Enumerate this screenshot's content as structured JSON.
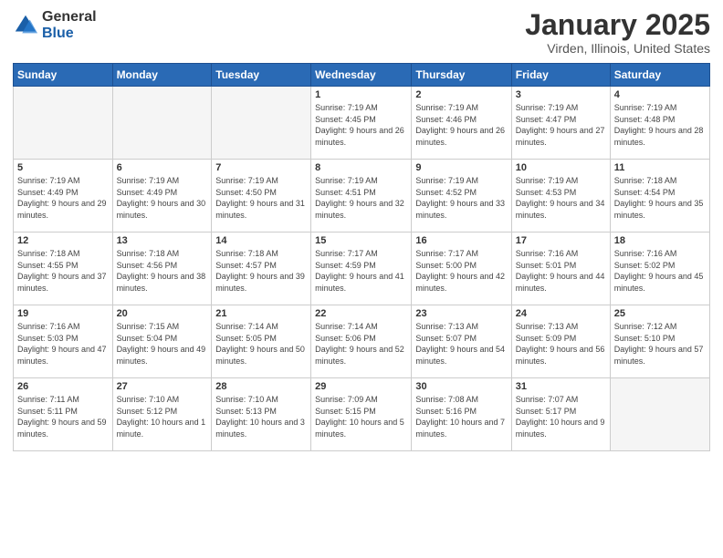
{
  "logo": {
    "general": "General",
    "blue": "Blue"
  },
  "title": "January 2025",
  "location": "Virden, Illinois, United States",
  "days_header": [
    "Sunday",
    "Monday",
    "Tuesday",
    "Wednesday",
    "Thursday",
    "Friday",
    "Saturday"
  ],
  "weeks": [
    [
      {
        "day": "",
        "info": ""
      },
      {
        "day": "",
        "info": ""
      },
      {
        "day": "",
        "info": ""
      },
      {
        "day": "1",
        "info": "Sunrise: 7:19 AM\nSunset: 4:45 PM\nDaylight: 9 hours and 26 minutes."
      },
      {
        "day": "2",
        "info": "Sunrise: 7:19 AM\nSunset: 4:46 PM\nDaylight: 9 hours and 26 minutes."
      },
      {
        "day": "3",
        "info": "Sunrise: 7:19 AM\nSunset: 4:47 PM\nDaylight: 9 hours and 27 minutes."
      },
      {
        "day": "4",
        "info": "Sunrise: 7:19 AM\nSunset: 4:48 PM\nDaylight: 9 hours and 28 minutes."
      }
    ],
    [
      {
        "day": "5",
        "info": "Sunrise: 7:19 AM\nSunset: 4:49 PM\nDaylight: 9 hours and 29 minutes."
      },
      {
        "day": "6",
        "info": "Sunrise: 7:19 AM\nSunset: 4:49 PM\nDaylight: 9 hours and 30 minutes."
      },
      {
        "day": "7",
        "info": "Sunrise: 7:19 AM\nSunset: 4:50 PM\nDaylight: 9 hours and 31 minutes."
      },
      {
        "day": "8",
        "info": "Sunrise: 7:19 AM\nSunset: 4:51 PM\nDaylight: 9 hours and 32 minutes."
      },
      {
        "day": "9",
        "info": "Sunrise: 7:19 AM\nSunset: 4:52 PM\nDaylight: 9 hours and 33 minutes."
      },
      {
        "day": "10",
        "info": "Sunrise: 7:19 AM\nSunset: 4:53 PM\nDaylight: 9 hours and 34 minutes."
      },
      {
        "day": "11",
        "info": "Sunrise: 7:18 AM\nSunset: 4:54 PM\nDaylight: 9 hours and 35 minutes."
      }
    ],
    [
      {
        "day": "12",
        "info": "Sunrise: 7:18 AM\nSunset: 4:55 PM\nDaylight: 9 hours and 37 minutes."
      },
      {
        "day": "13",
        "info": "Sunrise: 7:18 AM\nSunset: 4:56 PM\nDaylight: 9 hours and 38 minutes."
      },
      {
        "day": "14",
        "info": "Sunrise: 7:18 AM\nSunset: 4:57 PM\nDaylight: 9 hours and 39 minutes."
      },
      {
        "day": "15",
        "info": "Sunrise: 7:17 AM\nSunset: 4:59 PM\nDaylight: 9 hours and 41 minutes."
      },
      {
        "day": "16",
        "info": "Sunrise: 7:17 AM\nSunset: 5:00 PM\nDaylight: 9 hours and 42 minutes."
      },
      {
        "day": "17",
        "info": "Sunrise: 7:16 AM\nSunset: 5:01 PM\nDaylight: 9 hours and 44 minutes."
      },
      {
        "day": "18",
        "info": "Sunrise: 7:16 AM\nSunset: 5:02 PM\nDaylight: 9 hours and 45 minutes."
      }
    ],
    [
      {
        "day": "19",
        "info": "Sunrise: 7:16 AM\nSunset: 5:03 PM\nDaylight: 9 hours and 47 minutes."
      },
      {
        "day": "20",
        "info": "Sunrise: 7:15 AM\nSunset: 5:04 PM\nDaylight: 9 hours and 49 minutes."
      },
      {
        "day": "21",
        "info": "Sunrise: 7:14 AM\nSunset: 5:05 PM\nDaylight: 9 hours and 50 minutes."
      },
      {
        "day": "22",
        "info": "Sunrise: 7:14 AM\nSunset: 5:06 PM\nDaylight: 9 hours and 52 minutes."
      },
      {
        "day": "23",
        "info": "Sunrise: 7:13 AM\nSunset: 5:07 PM\nDaylight: 9 hours and 54 minutes."
      },
      {
        "day": "24",
        "info": "Sunrise: 7:13 AM\nSunset: 5:09 PM\nDaylight: 9 hours and 56 minutes."
      },
      {
        "day": "25",
        "info": "Sunrise: 7:12 AM\nSunset: 5:10 PM\nDaylight: 9 hours and 57 minutes."
      }
    ],
    [
      {
        "day": "26",
        "info": "Sunrise: 7:11 AM\nSunset: 5:11 PM\nDaylight: 9 hours and 59 minutes."
      },
      {
        "day": "27",
        "info": "Sunrise: 7:10 AM\nSunset: 5:12 PM\nDaylight: 10 hours and 1 minute."
      },
      {
        "day": "28",
        "info": "Sunrise: 7:10 AM\nSunset: 5:13 PM\nDaylight: 10 hours and 3 minutes."
      },
      {
        "day": "29",
        "info": "Sunrise: 7:09 AM\nSunset: 5:15 PM\nDaylight: 10 hours and 5 minutes."
      },
      {
        "day": "30",
        "info": "Sunrise: 7:08 AM\nSunset: 5:16 PM\nDaylight: 10 hours and 7 minutes."
      },
      {
        "day": "31",
        "info": "Sunrise: 7:07 AM\nSunset: 5:17 PM\nDaylight: 10 hours and 9 minutes."
      },
      {
        "day": "",
        "info": ""
      }
    ]
  ]
}
